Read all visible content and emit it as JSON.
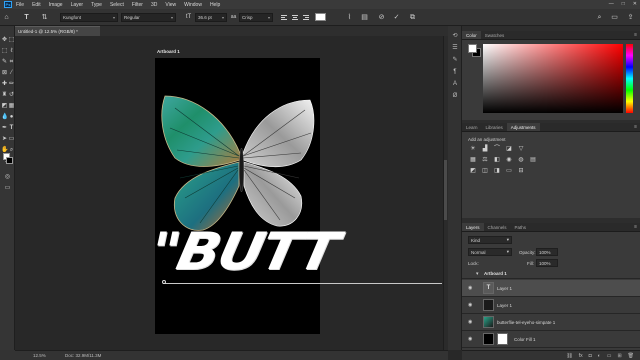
{
  "app": {
    "logo": "Ps"
  },
  "menu": [
    "File",
    "Edit",
    "Image",
    "Layer",
    "Type",
    "Select",
    "Filter",
    "3D",
    "View",
    "Window",
    "Help"
  ],
  "window_controls": {
    "minimize": "—",
    "maximize": "□",
    "close": "✕"
  },
  "options_bar": {
    "tool_glyph": "T",
    "font_family": "Kungfont",
    "font_style": "Regular",
    "font_size": "36.6 pt",
    "antialias": "Crisp",
    "color_swatch": "#ffffff"
  },
  "document": {
    "tab_title": "Untitled-1 @ 12.5% (RGB/8) *",
    "artboard_label": "Artboard 1",
    "canvas_text": "\"BUTT"
  },
  "status": {
    "zoom": "12.5%",
    "doc_size": "Doc: 32.9M/11.3M"
  },
  "color_panel": {
    "tabs": [
      "Color",
      "Swatches"
    ],
    "foreground": "#ffffff",
    "background": "#000000"
  },
  "adjustments_panel": {
    "tabs": [
      "Learn",
      "Libraries",
      "Adjustments"
    ],
    "label": "Add an adjustment"
  },
  "layers_panel": {
    "tabs": [
      "Layers",
      "Channels",
      "Paths"
    ],
    "kind_filter": "Kind",
    "blend_mode": "Normal",
    "opacity_label": "Opacity:",
    "opacity_value": "100%",
    "lock_label": "Lock:",
    "fill_label": "Fill:",
    "fill_value": "100%",
    "group": "Artboard 1",
    "layers": [
      {
        "name": "Layer 1",
        "thumb": "T"
      },
      {
        "name": "Layer 1",
        "thumb": ""
      },
      {
        "name": "butterflie-tel-eyeho-simpate 1",
        "thumb": ""
      },
      {
        "name": "Color Fill 1",
        "thumb": ""
      }
    ]
  },
  "icons": {
    "move": "move-icon",
    "marquee": "rectangular-marquee-icon",
    "lasso": "lasso-icon",
    "wand": "quick-selection-icon",
    "crop": "crop-icon",
    "eyedropper": "eyedropper-icon",
    "heal": "healing-brush-icon",
    "brush": "brush-icon",
    "stamp": "clone-stamp-icon",
    "history": "history-brush-icon",
    "eraser": "eraser-icon",
    "gradient": "gradient-icon",
    "blur": "blur-icon",
    "dodge": "dodge-icon",
    "pen": "pen-icon",
    "type": "type-icon",
    "path": "path-selection-icon",
    "shape": "rectangle-shape-icon",
    "hand": "hand-icon",
    "zoom": "zoom-icon"
  }
}
